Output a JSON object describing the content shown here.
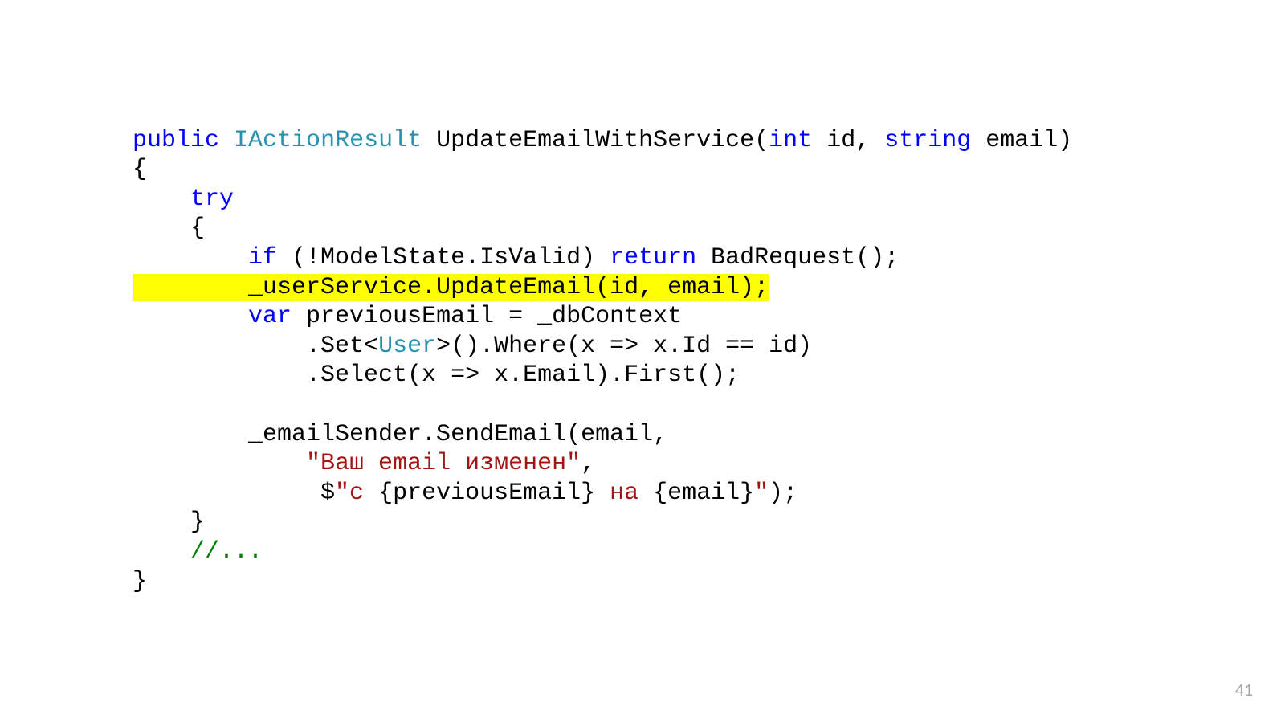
{
  "code": {
    "l1": {
      "kw_public": "public",
      "sp1": " ",
      "typ_iactionresult": "IActionResult",
      "txt_after_type": " UpdateEmailWithService(",
      "kw_int": "int",
      "txt_id": " id, ",
      "kw_string": "string",
      "txt_email_paren": " email)"
    },
    "l2": "{",
    "l3": {
      "indent": "    ",
      "kw_try": "try"
    },
    "l4": "    {",
    "l5": {
      "indent": "        ",
      "kw_if": "if",
      "txt_cond": " (!ModelState.IsValid) ",
      "kw_return": "return",
      "txt_bad": " BadRequest();"
    },
    "l6": {
      "hl_prefix": "        _userService.UpdateEmail(id, email);"
    },
    "l7": {
      "indent": "        ",
      "kw_var": "var",
      "txt_rest": " previousEmail = _dbContext"
    },
    "l8": {
      "txt_before": "            .Set<",
      "typ_user": "User",
      "txt_after": ">().Where(x => x.Id == id)"
    },
    "l9": "            .Select(x => x.Email).First();",
    "l10": "",
    "l11": "        _emailSender.SendEmail(email,",
    "l12": {
      "indent": "            ",
      "str": "\"Ваш email изменен\"",
      "comma": ","
    },
    "l13": {
      "indent": "             $",
      "str_open": "\"с ",
      "interp1": "{previousEmail}",
      "str_mid": " на ",
      "interp2": "{email}",
      "str_close": "\"",
      "tail": ");"
    },
    "l14": "    }",
    "l15": {
      "indent": "    ",
      "cmt": "//..."
    },
    "l16": "}"
  },
  "page_number": "41"
}
